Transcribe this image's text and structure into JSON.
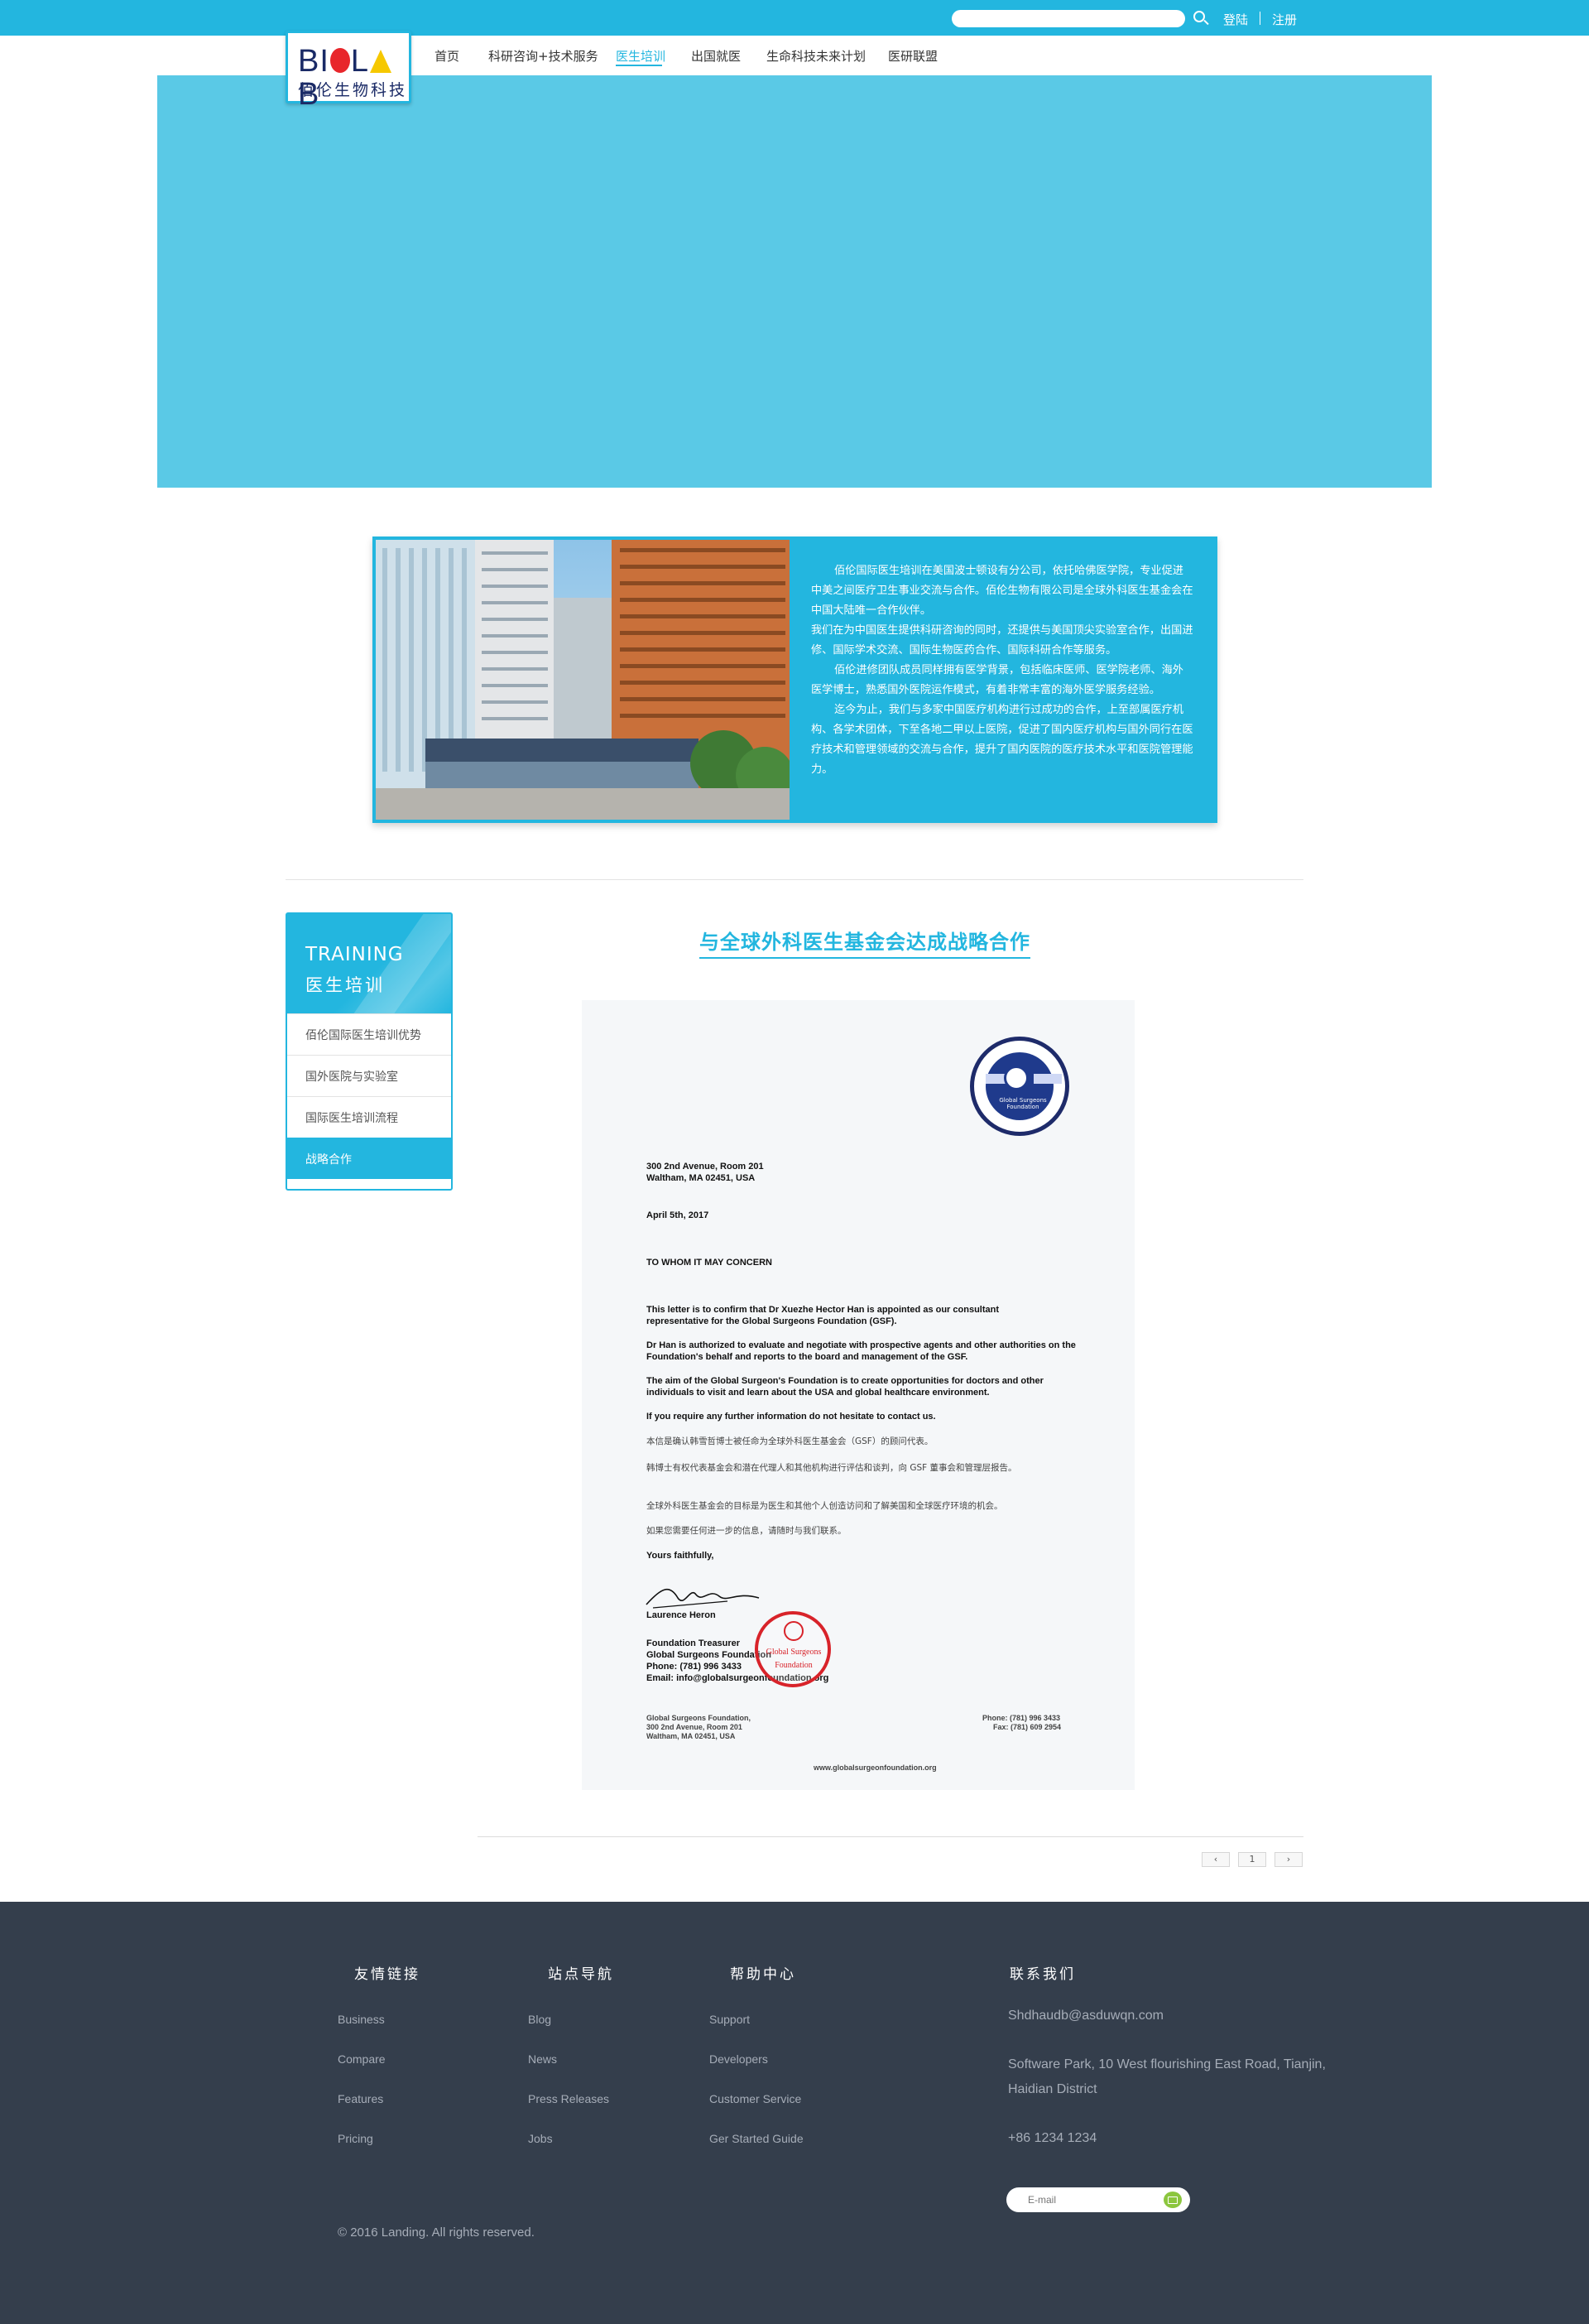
{
  "header": {
    "search_placeholder": "",
    "login": "登陆",
    "register": "注册"
  },
  "logo": {
    "word": "BIOLAB",
    "word_b": "B",
    "word_i": "I",
    "word_l1": "L",
    "word_b2": "B",
    "name_cn": "佰伦生物科技"
  },
  "nav": {
    "items": [
      {
        "label": "首页"
      },
      {
        "label": "科研咨询+技术服务"
      },
      {
        "label": "医生培训"
      },
      {
        "label": "出国就医"
      },
      {
        "label": "生命科技未来计划"
      },
      {
        "label": "医研联盟"
      }
    ],
    "active_index": 2
  },
  "intro": {
    "paragraphs": [
      "佰伦国际医生培训在美国波士顿设有分公司，依托哈佛医学院，专业促进中美之间医疗卫生事业交流与合作。佰伦生物有限公司是全球外科医生基金会在中国大陆唯一合作伙伴。",
      "我们在为中国医生提供科研咨询的同时，还提供与美国顶尖实验室合作，出国进修、国际学术交流、国际生物医药合作、国际科研合作等服务。",
      "佰伦进修团队成员同样拥有医学背景，包括临床医师、医学院老师、海外医学博士，熟悉国外医院运作模式，有着非常丰富的海外医学服务经验。",
      "迄今为止，我们与多家中国医疗机构进行过成功的合作，上至部属医疗机构、各学术团体，下至各地二甲以上医院，促进了国内医疗机构与国外同行在医疗技术和管理领域的交流与合作，提升了国内医院的医疗技术水平和医院管理能力。"
    ]
  },
  "sidebar": {
    "title_en": "TRAINING",
    "title_cn": "医生培训",
    "items": [
      {
        "label": "佰伦国际医生培训优势"
      },
      {
        "label": "国外医院与实验室"
      },
      {
        "label": "国际医生培训流程"
      },
      {
        "label": "战略合作"
      }
    ],
    "active_index": 3
  },
  "article": {
    "title": "与全球外科医生基金会达成战略合作"
  },
  "letter": {
    "seal_text": "Global Surgeons Foundation",
    "address1": "300 2nd Avenue, Room 201",
    "address2": "Waltham, MA 02451, USA",
    "date": "April 5th, 2017",
    "salutation": "TO WHOM IT MAY CONCERN",
    "para1": "This letter is to confirm that Dr Xuezhe Hector Han is appointed as our consultant representative for the Global Surgeons Foundation (GSF).",
    "para2": "Dr Han is authorized to evaluate and negotiate with prospective agents and other authorities on the Foundation's behalf and reports to the board and management of the GSF.",
    "para3": "The aim of the Global Surgeon's Foundation is to create opportunities for doctors and other individuals to visit and learn about the USA and global healthcare environment.",
    "para4": "If you require any further information do not hesitate to contact us.",
    "cn1": "本信是确认韩雪哲博士被任命为全球外科医生基金会（GSF）的顾问代表。",
    "cn2": "韩博士有权代表基金会和潜在代理人和其他机构进行评估和谈判，向 GSF 董事会和管理层报告。",
    "cn3": "全球外科医生基金会的目标是为医生和其他个人创造访问和了解美国和全球医疗环境的机会。",
    "cn4": "如果您需要任何进一步的信息，请随时与我们联系。",
    "closing": "Yours faithfully,",
    "signer": "Laurence Heron",
    "role": "Foundation Treasurer",
    "org": "Global Surgeons Foundation",
    "phone": "Phone: (781) 996 3433",
    "email": "Email: info@globalsurgeonfoundation.org",
    "stamp_line1": "Global Surgeons",
    "stamp_line2": "Foundation",
    "foot_left1": "Global Surgeons Foundation,",
    "foot_left2": "300 2nd Avenue, Room 201",
    "foot_left3": "Waltham, MA 02451, USA",
    "foot_right1": "Phone: (781) 996 3433",
    "foot_right2": "Fax: (781) 609 2954",
    "foot_web": "www.globalsurgeonfoundation.org"
  },
  "pagination": {
    "prev": "‹",
    "page": "1",
    "next": "›"
  },
  "footer": {
    "col1": {
      "heading": "友情链接",
      "links": [
        "Business",
        "Compare",
        "Features",
        "Pricing"
      ]
    },
    "col2": {
      "heading": "站点导航",
      "links": [
        "Blog",
        "News",
        "Press Releases",
        "Jobs"
      ]
    },
    "col3": {
      "heading": "帮助中心",
      "links": [
        "Support",
        "Developers",
        "Customer Service",
        "Ger Started Guide"
      ]
    },
    "contact": {
      "heading": "联系我们",
      "email": "Shdhaudb@asduwqn.com",
      "address": "Software Park, 10 West flourishing East Road, Tianjin, Haidian District",
      "phone": "+86 1234 1234",
      "newsletter_placeholder": "E-mail"
    },
    "copyright": "© 2016 Landing. All rights reserved."
  },
  "colors": {
    "accent": "#23b6df",
    "banner": "#5ac9e6",
    "footer": "#343e4c",
    "logo_red": "#e8262b",
    "logo_yellow": "#f6c800",
    "logo_navy": "#1a2a66"
  }
}
